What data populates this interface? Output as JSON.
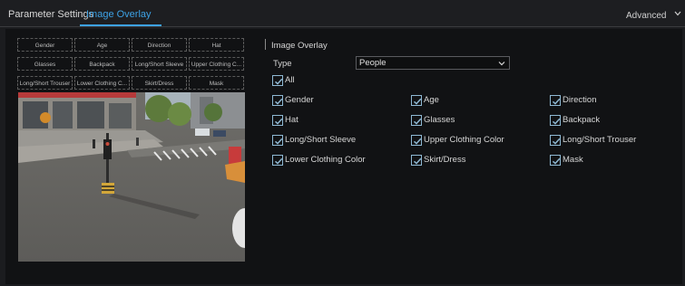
{
  "tabs": [
    {
      "label": "Parameter Settings",
      "active": false
    },
    {
      "label": "Image Overlay",
      "active": true
    }
  ],
  "advanced_label": "Advanced",
  "preview_tags": [
    [
      "Gender",
      "Age",
      "Direction",
      "Hat"
    ],
    [
      "Glasses",
      "Backpack",
      "Long/Short Sleeve",
      "Upper Clothing C..."
    ],
    [
      "Long/Short Trouser",
      "Lower Clothing C...",
      "Skirt/Dress",
      "Mask"
    ]
  ],
  "overlay": {
    "section_title": "Image Overlay",
    "type_label": "Type",
    "type_value": "People",
    "all_label": "All",
    "options": [
      "Gender",
      "Age",
      "Direction",
      "Hat",
      "Glasses",
      "Backpack",
      "Long/Short Sleeve",
      "Upper Clothing Color",
      "Long/Short Trouser",
      "Lower Clothing Color",
      "Skirt/Dress",
      "Mask"
    ]
  },
  "colors": {
    "accent": "#3da2e6",
    "check": "#8fb9d4"
  },
  "icons": {
    "advanced": "chevron-down-icon",
    "select": "chevron-down-icon",
    "checkbox": "check-icon"
  }
}
